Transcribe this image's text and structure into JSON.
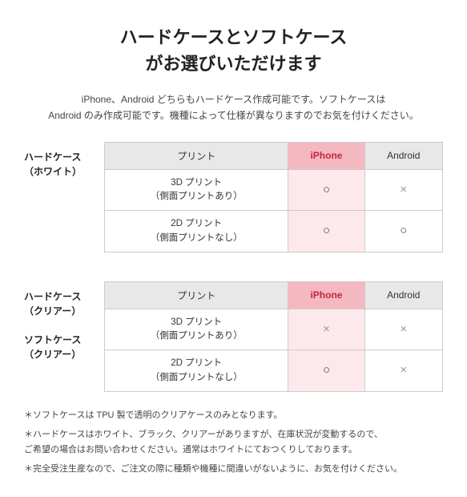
{
  "title": {
    "line1": "ハードケースとソフトケース",
    "line2": "がお選びいただけます"
  },
  "subtitle": "iPhone、Android どちらもハードケース作成可能です。ソフトケースは\nAndroid のみ作成可能です。機種によって仕様が異なりますのでお気を付けください。",
  "table1": {
    "row_label_line1": "ハードケース",
    "row_label_line2": "（ホワイト）",
    "headers": [
      "プリント",
      "iPhone",
      "Android"
    ],
    "rows": [
      {
        "label_line1": "3D プリント",
        "label_line2": "（側面プリントあり）",
        "iphone": "○",
        "android": "×"
      },
      {
        "label_line1": "2D プリント",
        "label_line2": "（側面プリントなし）",
        "iphone": "○",
        "android": "○"
      }
    ]
  },
  "table2": {
    "row_label_line1": "ハードケース",
    "row_label_line2": "（クリアー）",
    "row_label2_line1": "ソフトケース",
    "row_label2_line2": "（クリアー）",
    "headers": [
      "プリント",
      "iPhone",
      "Android"
    ],
    "rows": [
      {
        "label_line1": "3D プリント",
        "label_line2": "（側面プリントあり）",
        "iphone": "×",
        "android": "×"
      },
      {
        "label_line1": "2D プリント",
        "label_line2": "（側面プリントなし）",
        "iphone": "○",
        "android": "×"
      }
    ]
  },
  "notes": [
    "＊ソフトケースは TPU 製で透明のクリアケースのみとなります。",
    "＊ハードケースはホワイト、ブラック、クリアーがありますが、在庫状況が変動するので、\nご希望の場合はお問い合わせください。通常はホワイトにておつくりしております。",
    "＊完全受注生産なので、ご注文の際に種類や機種に間違いがないように、お気を付けください。"
  ]
}
